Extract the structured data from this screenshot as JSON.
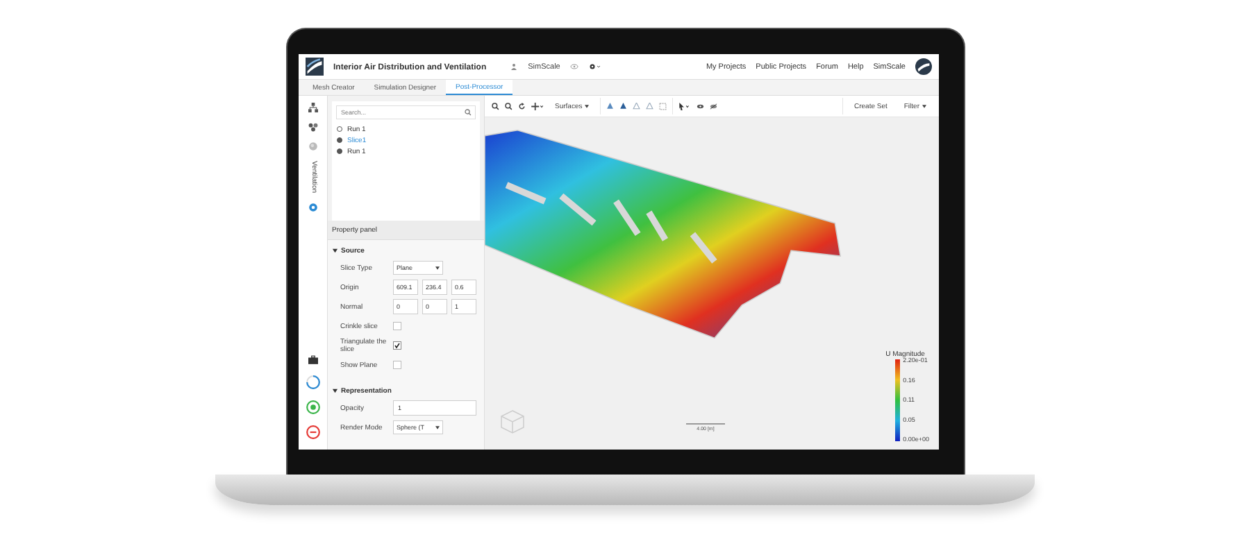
{
  "header": {
    "project_title": "Interior Air Distribution and Ventilation",
    "owner": "SimScale",
    "nav_links": [
      "My Projects",
      "Public Projects",
      "Forum",
      "Help",
      "SimScale"
    ]
  },
  "tabs": [
    {
      "label": "Mesh Creator",
      "selected": false
    },
    {
      "label": "Simulation Designer",
      "selected": false
    },
    {
      "label": "Post-Processor",
      "selected": true
    }
  ],
  "sidebar": {
    "vertical_label": "Ventilation"
  },
  "tree": {
    "search": {
      "placeholder": "Search..."
    },
    "items": [
      {
        "label": "Run 1",
        "selected": false
      },
      {
        "label": "Slice1",
        "selected": true
      },
      {
        "label": "Run 1",
        "selected": false
      }
    ]
  },
  "property_panel": {
    "title": "Property panel",
    "sections": [
      {
        "title": "Source",
        "expanded": true,
        "fields": [
          {
            "kind": "select",
            "label": "Slice Type",
            "value": "Plane"
          },
          {
            "kind": "vector",
            "label": "Origin",
            "values": [
              "609.1",
              "236.4",
              "0.6"
            ]
          },
          {
            "kind": "vector",
            "label": "Normal",
            "values": [
              "0",
              "0",
              "1"
            ]
          },
          {
            "kind": "checkbox",
            "label": "Crinkle slice",
            "checked": false
          },
          {
            "kind": "checkbox",
            "label": "Triangulate the slice",
            "checked": true
          },
          {
            "kind": "checkbox",
            "label": "Show Plane",
            "checked": false
          }
        ]
      },
      {
        "title": "Representation",
        "expanded": true,
        "fields": [
          {
            "kind": "text",
            "label": "Opacity",
            "value": "1"
          },
          {
            "kind": "select",
            "label": "Render Mode",
            "value": "Sphere (T"
          }
        ]
      }
    ]
  },
  "toolbar": {
    "surfaces": "Surfaces",
    "create_set": "Create Set",
    "filter": "Filter"
  },
  "legend": {
    "title": "U Magnitude",
    "labels": [
      "2.20e-01",
      "0.16",
      "0.11",
      "0.05",
      "0.00e+00"
    ]
  },
  "scale_bar": {
    "label": "4.00 [m]"
  }
}
